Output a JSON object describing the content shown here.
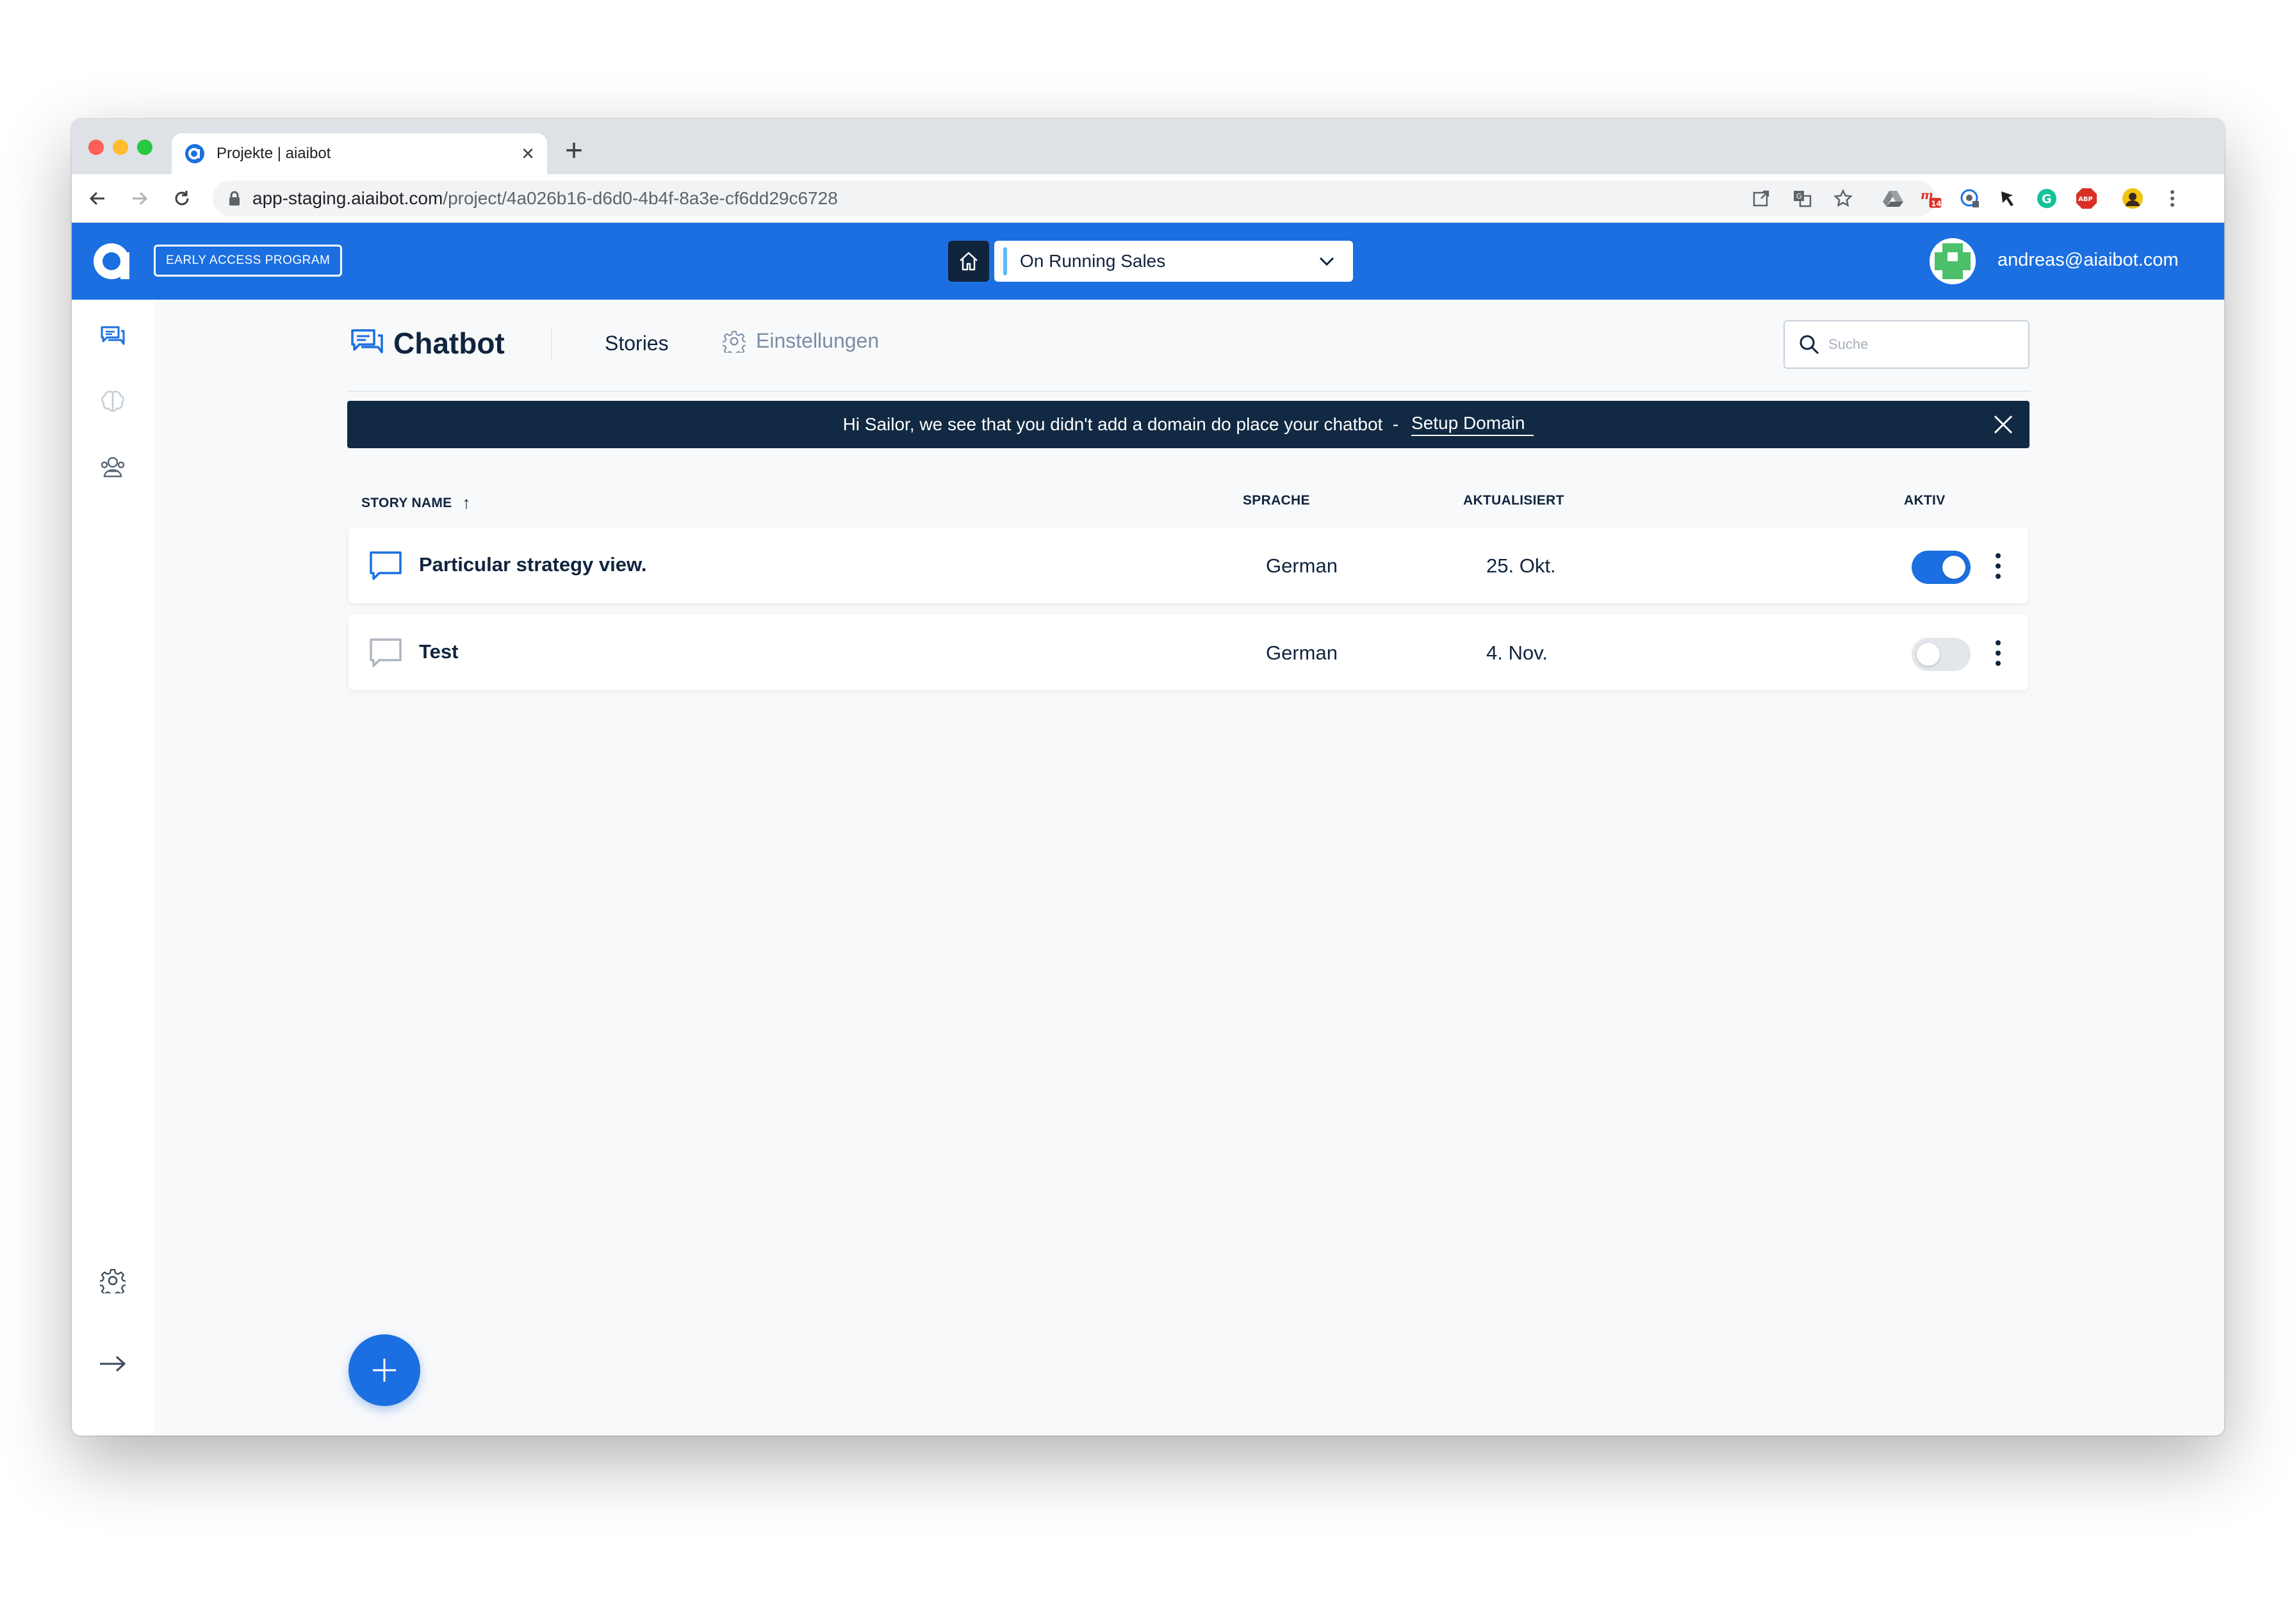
{
  "browser": {
    "tab_title": "Projekte | aiaibot",
    "tab_close": "×",
    "new_tab": "+",
    "url_host": "app-staging.aiaibot.com",
    "url_path": "/project/4a026b16-d6d0-4b4f-8a3e-cf6dd29c6728",
    "extensions": [
      "open-in-new-icon",
      "translate-icon",
      "bookmark-star-icon",
      "drive-icon",
      "extension-14-icon",
      "extension-icon",
      "cursor-extension-icon",
      "grammarly-icon",
      "adblock-icon",
      "profile-avatar-icon",
      "chrome-menu-icon"
    ],
    "extension_badge": "14",
    "adblock_label": "ABP"
  },
  "appbar": {
    "badge": "EARLY ACCESS PROGRAM",
    "project": "On Running Sales",
    "user_email": "andreas@aiaibot.com",
    "brand_color": "#1b6fe0",
    "dark_color": "#10243e"
  },
  "sidebar": {
    "items": [
      "chatbot-icon",
      "brain-icon",
      "team-icon"
    ],
    "bottom": [
      "settings-icon",
      "collapse-arrow-icon"
    ]
  },
  "page": {
    "title": "Chatbot",
    "tabs": {
      "stories": "Stories",
      "settings": "Einstellungen"
    },
    "search_placeholder": "Suche"
  },
  "banner": {
    "text": "Hi Sailor, we see that you didn't add a domain do place your chatbot  - ",
    "link": "Setup Domain"
  },
  "table": {
    "columns": {
      "name": "STORY NAME",
      "language": "SPRACHE",
      "updated": "AKTUALISIERT",
      "active": "AKTIV"
    },
    "sort_indicator": "↑",
    "rows": [
      {
        "name": "Particular strategy view.",
        "language": "German",
        "updated": "25. Okt.",
        "active": true
      },
      {
        "name": "Test",
        "language": "German",
        "updated": "4. Nov.",
        "active": false
      }
    ]
  }
}
